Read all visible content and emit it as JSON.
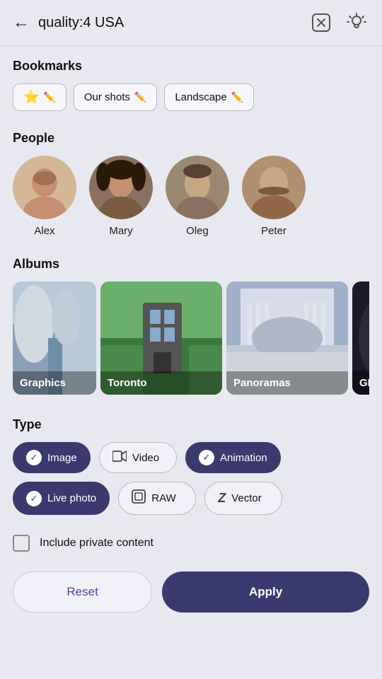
{
  "header": {
    "title": "quality:4 USA",
    "back_label": "←",
    "clear_icon": "clear-search-icon",
    "bulb_icon": "bulb-icon"
  },
  "bookmarks": {
    "section_title": "Bookmarks",
    "items": [
      {
        "id": "star",
        "label": "",
        "icon": "⭐",
        "edit": true
      },
      {
        "id": "our-shots",
        "label": "Our shots",
        "edit": true
      },
      {
        "id": "landscape",
        "label": "Landscape",
        "edit": true
      }
    ]
  },
  "people": {
    "section_title": "People",
    "items": [
      {
        "id": "alex",
        "name": "Alex",
        "color": "#c4a882"
      },
      {
        "id": "mary",
        "name": "Mary",
        "color": "#8b7660"
      },
      {
        "id": "oleg",
        "name": "Oleg",
        "color": "#9a8870"
      },
      {
        "id": "peter",
        "name": "Peter",
        "color": "#b09070"
      }
    ]
  },
  "albums": {
    "section_title": "Albums",
    "items": [
      {
        "id": "graphics",
        "label": "Graphics",
        "class": "album-graphics"
      },
      {
        "id": "toronto",
        "label": "Toronto",
        "class": "album-toronto"
      },
      {
        "id": "panoramas",
        "label": "Panoramas",
        "class": "album-panoramas"
      },
      {
        "id": "gif",
        "label": "GIF",
        "class": "album-gif"
      }
    ]
  },
  "type": {
    "section_title": "Type",
    "items": [
      {
        "id": "image",
        "label": "Image",
        "icon": "✓",
        "icon_type": "check",
        "selected": true
      },
      {
        "id": "video",
        "label": "Video",
        "icon": "▶",
        "icon_type": "symbol",
        "selected": false
      },
      {
        "id": "animation",
        "label": "Animation",
        "icon": "✓",
        "icon_type": "check",
        "selected": true
      },
      {
        "id": "live-photo",
        "label": "Live photo",
        "icon": "✓",
        "icon_type": "check",
        "selected": true
      },
      {
        "id": "raw",
        "label": "RAW",
        "icon": "⊡",
        "icon_type": "symbol",
        "selected": false
      },
      {
        "id": "vector",
        "label": "Vector",
        "icon": "Z",
        "icon_type": "symbol",
        "selected": false
      }
    ]
  },
  "private": {
    "label": "Include private content",
    "checked": false
  },
  "buttons": {
    "reset": "Reset",
    "apply": "Apply"
  }
}
